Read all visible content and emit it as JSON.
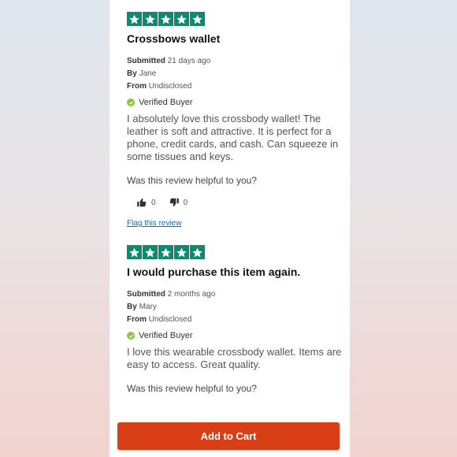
{
  "reviews": [
    {
      "title": "Crossbows wallet",
      "submitted_label": "Submitted",
      "submitted_value": "21 days ago",
      "by_label": "By",
      "by_value": "Jane",
      "from_label": "From",
      "from_value": "Undisclosed",
      "verified": "Verified Buyer",
      "body": "I absolutely love this crossbody wallet! The leather is soft and attractive. It is perfect for a phone, credit cards, and cash. Can squeeze in some tissues and keys.",
      "helpful": "Was this review helpful to you?",
      "up_count": "0",
      "down_count": "0",
      "flag": "Flag this review"
    },
    {
      "title": "I would purchase this item again.",
      "submitted_label": "Submitted",
      "submitted_value": "2 months ago",
      "by_label": "By",
      "by_value": "Mary",
      "from_label": "From",
      "from_value": "Undisclosed",
      "verified": "Verified Buyer",
      "body": "I love this wearable crossbody wallet. Items are easy to access. Great quality.",
      "helpful": "Was this review helpful to you?"
    }
  ],
  "cart": {
    "label": "Add to Cart"
  },
  "colors": {
    "star": "#0e8a6e",
    "button": "#d83f17",
    "verified": "#8cc63e",
    "link": "#0b6fb5"
  }
}
